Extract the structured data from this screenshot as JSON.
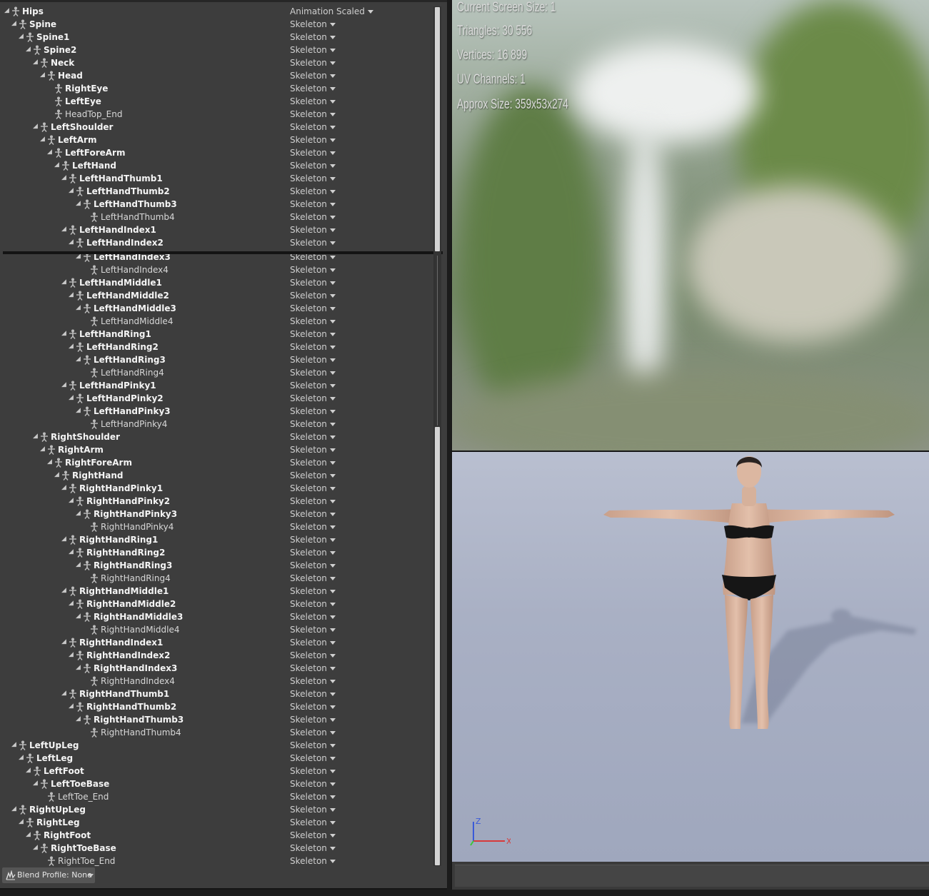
{
  "tree": {
    "header_setting": "Animation Scaled",
    "default_setting": "Skeleton",
    "bones": [
      {
        "name": "Hips",
        "depth": 0,
        "kind": "root"
      },
      {
        "name": "Spine",
        "depth": 1,
        "kind": "bold"
      },
      {
        "name": "Spine1",
        "depth": 2,
        "kind": "bold"
      },
      {
        "name": "Spine2",
        "depth": 3,
        "kind": "bold"
      },
      {
        "name": "Neck",
        "depth": 4,
        "kind": "bold"
      },
      {
        "name": "Head",
        "depth": 5,
        "kind": "bold"
      },
      {
        "name": "RightEye",
        "depth": 6,
        "kind": "bold-noarrow"
      },
      {
        "name": "LeftEye",
        "depth": 6,
        "kind": "bold-noarrow"
      },
      {
        "name": "HeadTop_End",
        "depth": 6,
        "kind": "leaf"
      },
      {
        "name": "LeftShoulder",
        "depth": 4,
        "kind": "bold"
      },
      {
        "name": "LeftArm",
        "depth": 5,
        "kind": "bold"
      },
      {
        "name": "LeftForeArm",
        "depth": 6,
        "kind": "bold"
      },
      {
        "name": "LeftHand",
        "depth": 7,
        "kind": "bold"
      },
      {
        "name": "LeftHandThumb1",
        "depth": 8,
        "kind": "bold"
      },
      {
        "name": "LeftHandThumb2",
        "depth": 9,
        "kind": "bold"
      },
      {
        "name": "LeftHandThumb3",
        "depth": 10,
        "kind": "bold"
      },
      {
        "name": "LeftHandThumb4",
        "depth": 11,
        "kind": "leaf"
      },
      {
        "name": "LeftHandIndex1",
        "depth": 8,
        "kind": "bold"
      },
      {
        "name": "LeftHandIndex2",
        "depth": 9,
        "kind": "bold"
      },
      {
        "name": "LeftHandIndex3",
        "depth": 10,
        "kind": "bold"
      },
      {
        "name": "LeftHandIndex4",
        "depth": 11,
        "kind": "leaf"
      },
      {
        "name": "LeftHandMiddle1",
        "depth": 8,
        "kind": "bold"
      },
      {
        "name": "LeftHandMiddle2",
        "depth": 9,
        "kind": "bold"
      },
      {
        "name": "LeftHandMiddle3",
        "depth": 10,
        "kind": "bold"
      },
      {
        "name": "LeftHandMiddle4",
        "depth": 11,
        "kind": "leaf"
      },
      {
        "name": "LeftHandRing1",
        "depth": 8,
        "kind": "bold"
      },
      {
        "name": "LeftHandRing2",
        "depth": 9,
        "kind": "bold"
      },
      {
        "name": "LeftHandRing3",
        "depth": 10,
        "kind": "bold"
      },
      {
        "name": "LeftHandRing4",
        "depth": 11,
        "kind": "leaf"
      },
      {
        "name": "LeftHandPinky1",
        "depth": 8,
        "kind": "bold"
      },
      {
        "name": "LeftHandPinky2",
        "depth": 9,
        "kind": "bold"
      },
      {
        "name": "LeftHandPinky3",
        "depth": 10,
        "kind": "bold"
      },
      {
        "name": "LeftHandPinky4",
        "depth": 11,
        "kind": "leaf"
      },
      {
        "name": "RightShoulder",
        "depth": 4,
        "kind": "bold"
      },
      {
        "name": "RightArm",
        "depth": 5,
        "kind": "bold"
      },
      {
        "name": "RightForeArm",
        "depth": 6,
        "kind": "bold"
      },
      {
        "name": "RightHand",
        "depth": 7,
        "kind": "bold"
      },
      {
        "name": "RightHandPinky1",
        "depth": 8,
        "kind": "bold"
      },
      {
        "name": "RightHandPinky2",
        "depth": 9,
        "kind": "bold"
      },
      {
        "name": "RightHandPinky3",
        "depth": 10,
        "kind": "bold"
      },
      {
        "name": "RightHandPinky4",
        "depth": 11,
        "kind": "leaf"
      },
      {
        "name": "RightHandRing1",
        "depth": 8,
        "kind": "bold"
      },
      {
        "name": "RightHandRing2",
        "depth": 9,
        "kind": "bold"
      },
      {
        "name": "RightHandRing3",
        "depth": 10,
        "kind": "bold"
      },
      {
        "name": "RightHandRing4",
        "depth": 11,
        "kind": "leaf"
      },
      {
        "name": "RightHandMiddle1",
        "depth": 8,
        "kind": "bold"
      },
      {
        "name": "RightHandMiddle2",
        "depth": 9,
        "kind": "bold"
      },
      {
        "name": "RightHandMiddle3",
        "depth": 10,
        "kind": "bold"
      },
      {
        "name": "RightHandMiddle4",
        "depth": 11,
        "kind": "leaf"
      },
      {
        "name": "RightHandIndex1",
        "depth": 8,
        "kind": "bold"
      },
      {
        "name": "RightHandIndex2",
        "depth": 9,
        "kind": "bold"
      },
      {
        "name": "RightHandIndex3",
        "depth": 10,
        "kind": "bold"
      },
      {
        "name": "RightHandIndex4",
        "depth": 11,
        "kind": "leaf"
      },
      {
        "name": "RightHandThumb1",
        "depth": 8,
        "kind": "bold"
      },
      {
        "name": "RightHandThumb2",
        "depth": 9,
        "kind": "bold"
      },
      {
        "name": "RightHandThumb3",
        "depth": 10,
        "kind": "bold"
      },
      {
        "name": "RightHandThumb4",
        "depth": 11,
        "kind": "leaf"
      },
      {
        "name": "LeftUpLeg",
        "depth": 1,
        "kind": "bold"
      },
      {
        "name": "LeftLeg",
        "depth": 2,
        "kind": "bold"
      },
      {
        "name": "LeftFoot",
        "depth": 3,
        "kind": "bold"
      },
      {
        "name": "LeftToeBase",
        "depth": 4,
        "kind": "bold"
      },
      {
        "name": "LeftToe_End",
        "depth": 5,
        "kind": "leaf"
      },
      {
        "name": "RightUpLeg",
        "depth": 1,
        "kind": "bold"
      },
      {
        "name": "RightLeg",
        "depth": 2,
        "kind": "bold"
      },
      {
        "name": "RightFoot",
        "depth": 3,
        "kind": "bold"
      },
      {
        "name": "RightToeBase",
        "depth": 4,
        "kind": "bold"
      },
      {
        "name": "RightToe_End",
        "depth": 5,
        "kind": "leaf"
      }
    ]
  },
  "blend_profile": {
    "label": "Blend Profile: None"
  },
  "preview_stats": {
    "screen_size": "Current Screen Size: 1",
    "triangles": "Triangles: 30 556",
    "vertices": "Vertices: 16 899",
    "uv_channels": "UV Channels: 1",
    "approx_size": "Approx Size: 359x53x274"
  },
  "axis": {
    "z_label": "Z",
    "x_label": "X"
  },
  "colors": {
    "panel_bg": "#3d3d3d",
    "axis_x": "#d83a3a",
    "axis_z": "#3a5ad8",
    "axis_y": "#3ac83a"
  }
}
